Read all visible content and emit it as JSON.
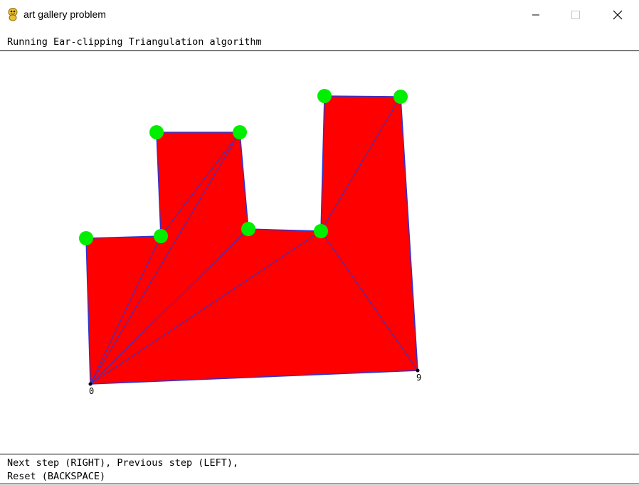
{
  "window": {
    "title": "art gallery problem",
    "icon": "pygame-snake-icon",
    "controls": [
      "minimize-icon",
      "maximize-icon",
      "close-icon"
    ]
  },
  "status": {
    "text": "Running Ear-clipping Triangulation algorithm"
  },
  "help": {
    "line1": "Next step (RIGHT), Previous step (LEFT),",
    "line2": "Reset (BACKSPACE)"
  },
  "colors": {
    "polygon_fill": "#ff0000",
    "edge": "#3333cc",
    "vertex_marker": "#00ee00",
    "vertex_dot": "#000000"
  },
  "vertex_labels": [
    {
      "index": 0,
      "label": "0"
    },
    {
      "index": 9,
      "label": "9"
    }
  ]
}
